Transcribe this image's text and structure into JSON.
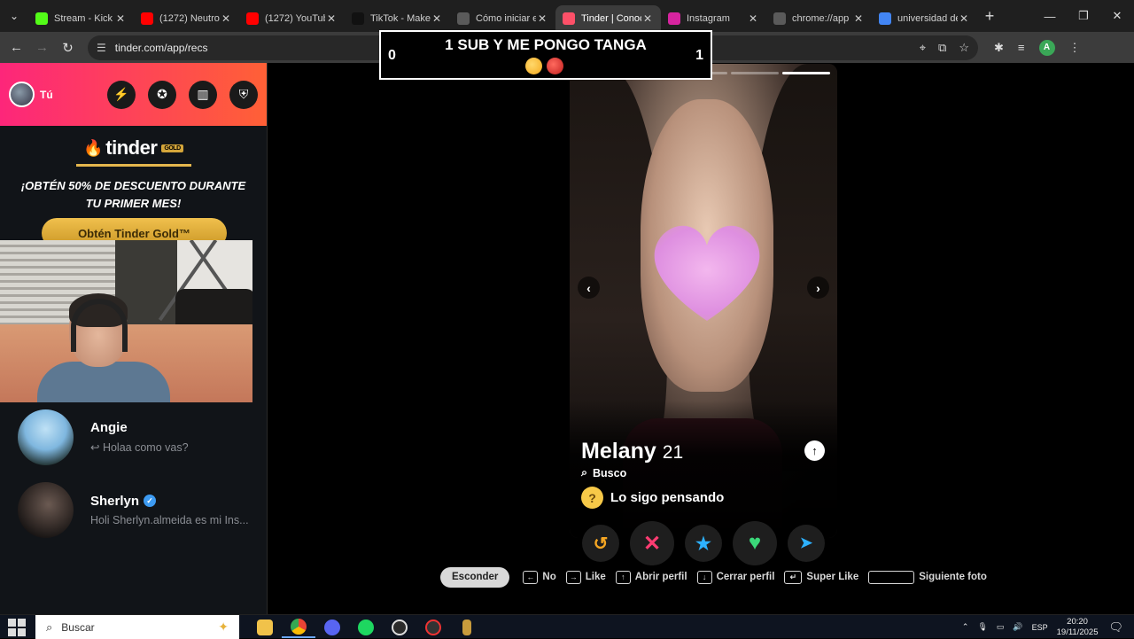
{
  "browser": {
    "tabs": [
      {
        "title": "Stream - Kick",
        "favicon": "kick-icon",
        "color": "#53fc18",
        "active": false
      },
      {
        "title": "(1272) Neutro",
        "favicon": "youtube-icon",
        "color": "#ff0000",
        "active": false
      },
      {
        "title": "(1272) YouTub",
        "favicon": "youtube-icon",
        "color": "#ff0000",
        "active": false
      },
      {
        "title": "TikTok - Make",
        "favicon": "tiktok-icon",
        "color": "#111111",
        "active": false
      },
      {
        "title": "Cómo iniciar e",
        "favicon": "globe-icon",
        "color": "#5a5a5a",
        "active": false
      },
      {
        "title": "Tinder | Conoc",
        "favicon": "tinder-icon",
        "color": "#fd5068",
        "active": true
      },
      {
        "title": "Instagram",
        "favicon": "instagram-icon",
        "color": "#d6249f",
        "active": false
      },
      {
        "title": "chrome://app",
        "favicon": "globe-icon",
        "color": "#5a5a5a",
        "active": false
      },
      {
        "title": "universidad de",
        "favicon": "google-icon",
        "color": "#4285f4",
        "active": false
      }
    ],
    "url": "tinder.com/app/recs",
    "profile_initial": "A"
  },
  "overlay": {
    "title": "1 SUB Y ME PONGO TANGA",
    "left_count": "0",
    "right_count": "1"
  },
  "sidebar": {
    "me_label": "Tú",
    "gold": {
      "logo": "tinder",
      "logo_tag": "GOLD",
      "promo_line1": "¡OBTÉN 50% DE DESCUENTO DURANTE",
      "promo_line2": "TU PRIMER MES!",
      "button": "Obtén Tinder Gold™"
    },
    "matches": [
      {
        "name": "Angie",
        "message": "↩ Holaa como vas?",
        "verified": false
      },
      {
        "name": "Sherlyn",
        "message": "Holi Sherlyn.almeida es mi Ins...",
        "verified": true
      }
    ]
  },
  "profile": {
    "name": "Melany",
    "age": "21",
    "looking_for_label": "Busco",
    "intent": "Lo sigo pensando",
    "photo_count": 5,
    "current_photo": 5
  },
  "shortcuts": {
    "hide": "Esconder",
    "items": [
      {
        "key": "←",
        "label": "No"
      },
      {
        "key": "→",
        "label": "Like"
      },
      {
        "key": "↑",
        "label": "Abrir perfil"
      },
      {
        "key": "↓",
        "label": "Cerrar perfil"
      },
      {
        "key": "↵",
        "label": "Super Like"
      },
      {
        "key": "",
        "label": "Siguiente foto"
      }
    ]
  },
  "taskbar": {
    "search_placeholder": "Buscar",
    "language": "ESP",
    "time": "20:20",
    "date": "19/11/2025"
  },
  "colors": {
    "tinder_gradient_start": "#fd267a",
    "tinder_gradient_end": "#ff6036",
    "gold": "#e4b64d",
    "nope": "#fe3c72",
    "superlike": "#2db1ff",
    "like": "#3ad879",
    "rewind": "#f5a623",
    "boost": "#a056ff"
  }
}
